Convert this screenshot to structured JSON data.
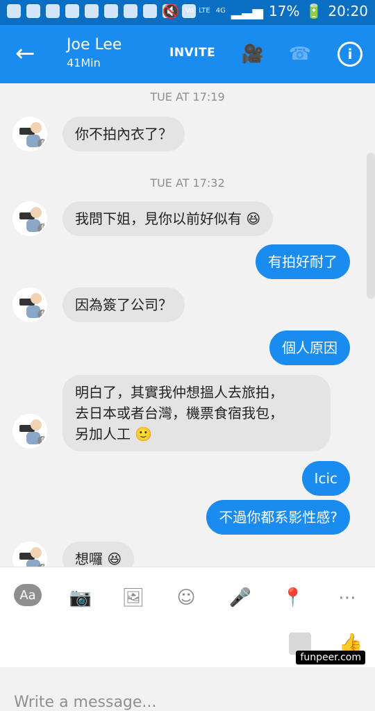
{
  "status_bar": {
    "lte": "Vo) LTE",
    "network": "4G",
    "battery": "17%",
    "time": "20:20"
  },
  "header": {
    "contact_name": "Joe Lee",
    "status": "41Min",
    "invite": "INVITE",
    "icons": {
      "back": "arrow-left-icon",
      "video": "video-camera-icon",
      "call": "phone-icon",
      "info": "info-icon"
    }
  },
  "conversation": {
    "timestamps": [
      "TUE AT 17:19",
      "TUE AT 17:32"
    ],
    "messages": [
      "你不拍內衣了？",
      "我問下姐，見你以前好似有",
      "有拍好耐了",
      "因為簽了公司？",
      "個人原因",
      "明白了，其實我仲想搵人去旅拍，",
      "去日本或者台灣，機票食宿我包，",
      "另加人工",
      "Icic",
      "不過你都系影性感?",
      "想囉"
    ]
  },
  "composer": {
    "placeholder": "Write a message...",
    "toolbar": {
      "aa": "Aa",
      "camera": "camera-icon",
      "image": "image-icon",
      "emoji": "smiley-icon",
      "mic": "mic-icon",
      "location": "location-icon",
      "more": "more-icon",
      "like": "thumb-up-icon",
      "stickers": "stickers-icon"
    }
  },
  "watermark": "funpeer.com",
  "colors": {
    "status_bar": "#0a6fc2",
    "app_bar": "#1a8cf0",
    "incoming_bubble": "#e4e4e4",
    "outgoing_bubble": "#1a8cf0",
    "background": "#f2f2f2"
  }
}
